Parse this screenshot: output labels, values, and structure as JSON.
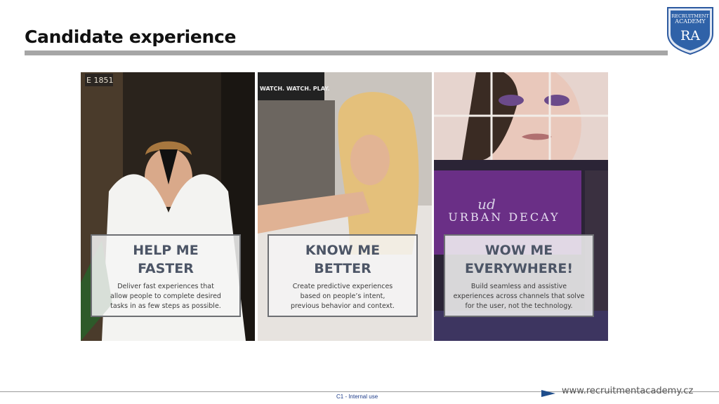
{
  "slide": {
    "title": "Candidate experience",
    "logo": {
      "line1": "RECRUITMENT",
      "line2": "ACADEMY",
      "monogram": "RA"
    },
    "panels": [
      {
        "heading": "HELP ME\nFASTER",
        "body": "Deliver fast experiences that\nallow people to complete desired\ntasks in as few steps as possible."
      },
      {
        "heading": "KNOW ME\nBETTER",
        "body": "Create predictive experiences\nbased on people’s intent,\nprevious behavior and context."
      },
      {
        "heading": "WOW ME\nEVERYWHERE!",
        "body": "Build seamless and assistive\nexperiences across channels that solve\nfor the user, not the technology."
      }
    ],
    "scene_text": {
      "sign1": "E 1851",
      "sign2": "WATCH. WATCH. PLAY.",
      "brand": "URBAN DECAY",
      "brand_mono": "ud"
    },
    "footer": {
      "classification": "C1 - Internal use",
      "url": "www.recruitmentacademy.cz"
    }
  }
}
